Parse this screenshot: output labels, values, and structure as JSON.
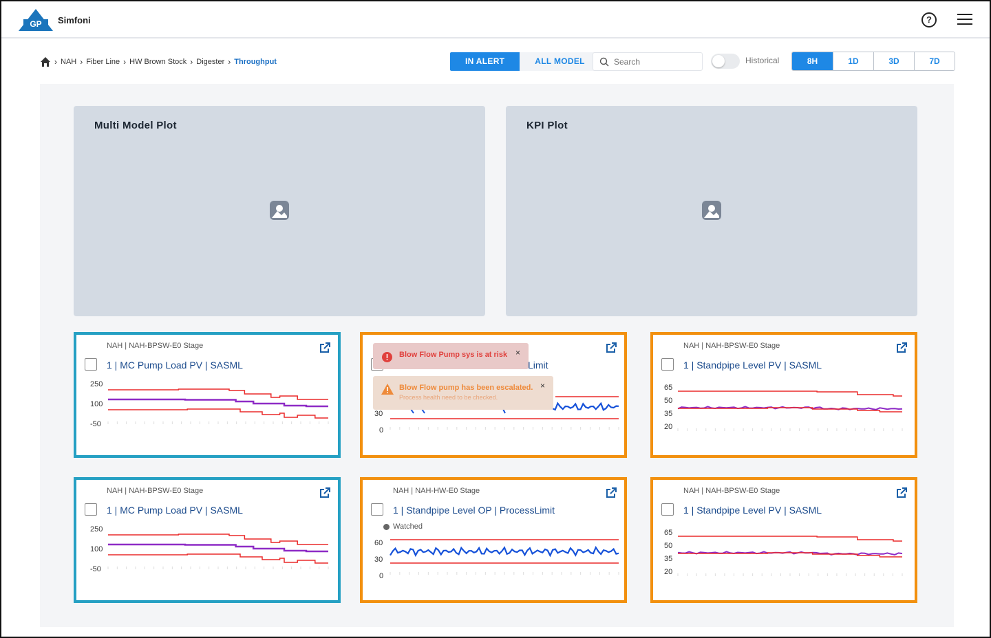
{
  "app": {
    "brand": "Simfoni",
    "logo_text": "GP"
  },
  "header": {
    "help_icon": "help-circle-icon",
    "help_glyph": "?",
    "menu_icon": "hamburger-menu-icon"
  },
  "breadcrumb": [
    "NAH",
    "Fiber Line",
    "HW Brown Stock",
    "Digester",
    "Throughput"
  ],
  "filters": {
    "in_alert": "IN ALERT",
    "all_model": "ALL MODEL",
    "search_placeholder": "Search",
    "historical": "Historical",
    "historical_on": false,
    "ranges": [
      "8H",
      "1D",
      "3D",
      "7D"
    ],
    "selected_range": "8H"
  },
  "plots": {
    "multi_model": "Multi Model Plot",
    "kpi": "KPI Plot"
  },
  "cards": [
    {
      "stage": "NAH | NAH-BPSW-E0 Stage",
      "title": "1 | MC Pump Load PV | SASML",
      "color": "#25a0c3",
      "yticks": [
        "250",
        "100",
        "-50"
      ],
      "kind": "sasml-pump"
    },
    {
      "stage": "",
      "title": "Limit",
      "color": "#f2900f",
      "yticks": [
        "30",
        "0"
      ],
      "kind": "process-partial"
    },
    {
      "stage": "NAH | NAH-BPSW-E0 Stage",
      "title": "1 | Standpipe Level PV | SASML",
      "color": "#f2900f",
      "yticks": [
        "65",
        "50",
        "35",
        "20"
      ],
      "kind": "sasml-level"
    },
    {
      "stage": "NAH | NAH-BPSW-E0 Stage",
      "title": "1 | MC Pump Load PV | SASML",
      "color": "#25a0c3",
      "yticks": [
        "250",
        "100",
        "-50"
      ],
      "kind": "sasml-pump"
    },
    {
      "stage": "NAH | NAH-HW-E0 Stage",
      "title": "1 | Standpipe Level OP | ProcessLimit",
      "color": "#f2900f",
      "watched": "Watched",
      "yticks": [
        "60",
        "30",
        "0"
      ],
      "kind": "process"
    },
    {
      "stage": "NAH | NAH-BPSW-E0 Stage",
      "title": "1 | Standpipe Level PV | SASML",
      "color": "#f2900f",
      "yticks": [
        "65",
        "50",
        "35",
        "20"
      ],
      "kind": "sasml-level"
    }
  ],
  "toasts": {
    "error": {
      "message": "Blow Flow Pump sys is at risk",
      "color": "#e0403c"
    },
    "warning": {
      "message": "Blow Flow pump has been escalated.",
      "detail": "Process health need to be checked.",
      "color": "#ee8a3a"
    },
    "close_glyph": "×"
  }
}
